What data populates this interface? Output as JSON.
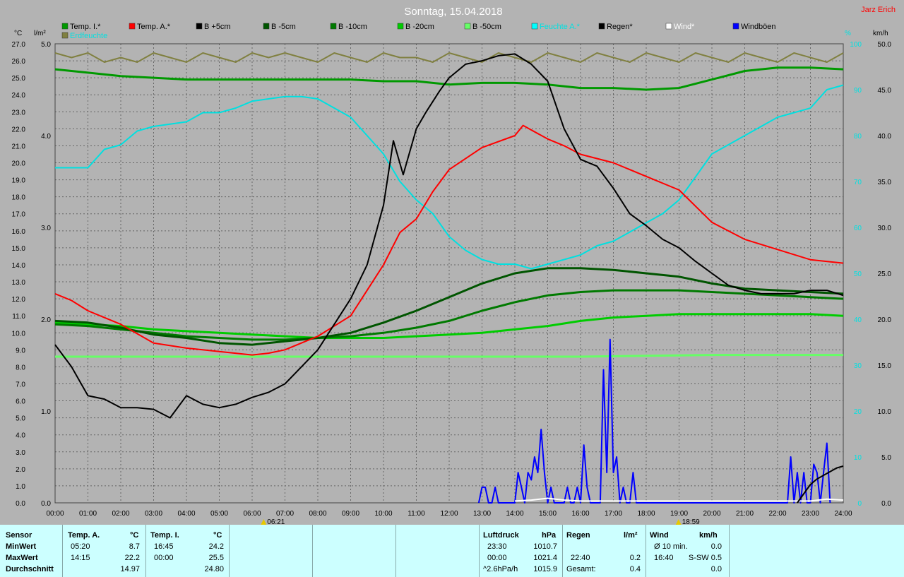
{
  "header": {
    "title": "Sonntag, 15.04.2018",
    "author": "Jarz Erich"
  },
  "colors": {
    "background": "#b3b3b3",
    "panel": "#ccffff",
    "grid": "#666666"
  },
  "units": {
    "left_temp": "°C",
    "left_rain": "l/m²",
    "right_percent": "%",
    "right_wind": "km/h"
  },
  "legend": [
    {
      "label": "Temp. I.*",
      "color": "#009900"
    },
    {
      "label": "Temp. A.*",
      "color": "#ff0000"
    },
    {
      "label": "B +5cm",
      "color": "#000000"
    },
    {
      "label": "B -5cm",
      "color": "#005500"
    },
    {
      "label": "B -10cm",
      "color": "#007a00"
    },
    {
      "label": "B -20cm",
      "color": "#00cc00"
    },
    {
      "label": "B -50cm",
      "color": "#66ff66"
    },
    {
      "label": "Feuchte A.*",
      "color": "#00ffff"
    },
    {
      "label": "Regen*",
      "color": "#000000"
    },
    {
      "label": "Wind*",
      "color": "#ffffff"
    },
    {
      "label": "Windböen",
      "color": "#0000ff"
    },
    {
      "label": "Erdfeuchte",
      "color": "#808040"
    }
  ],
  "chart_data": {
    "type": "line",
    "title": "Sonntag, 15.04.2018",
    "x_ticks": [
      "00:00",
      "01:00",
      "02:00",
      "03:00",
      "04:00",
      "05:00",
      "06:00",
      "07:00",
      "08:00",
      "09:00",
      "10:00",
      "11:00",
      "12:00",
      "13:00",
      "14:00",
      "15:00",
      "16:00",
      "17:00",
      "18:00",
      "19:00",
      "20:00",
      "21:00",
      "22:00",
      "23:00",
      "24:00"
    ],
    "xlim": [
      0,
      24
    ],
    "y_temp_ticks": [
      "0.0",
      "1.0",
      "2.0",
      "3.0",
      "4.0",
      "5.0",
      "6.0",
      "7.0",
      "8.0",
      "9.0",
      "10.0",
      "11.0",
      "12.0",
      "13.0",
      "14.0",
      "15.0",
      "16.0",
      "17.0",
      "18.0",
      "19.0",
      "20.0",
      "21.0",
      "22.0",
      "23.0",
      "24.0",
      "25.0",
      "26.0",
      "27.0"
    ],
    "y_temp_lim": [
      0,
      27
    ],
    "y_rain_ticks": [
      "0.0",
      "1.0",
      "2.0",
      "3.0",
      "4.0",
      "5.0"
    ],
    "y_rain_lim": [
      0,
      5
    ],
    "y_percent_ticks": [
      "0",
      "10",
      "20",
      "30",
      "40",
      "50",
      "60",
      "70",
      "80",
      "90",
      "100"
    ],
    "y_percent_lim": [
      0,
      100
    ],
    "y_wind_ticks": [
      "0.0",
      "5.0",
      "10.0",
      "15.0",
      "20.0",
      "25.0",
      "30.0",
      "35.0",
      "40.0",
      "45.0",
      "50.0"
    ],
    "y_wind_lim": [
      0,
      50
    ],
    "sunrise": "06:21",
    "sunset": "18:59",
    "series": [
      {
        "name": "Temp. I.*",
        "axis": "temp",
        "color": "#009900",
        "x": [
          0,
          1,
          2,
          3,
          4,
          5,
          6,
          7,
          8,
          9,
          10,
          11,
          12,
          13,
          14,
          15,
          16,
          17,
          18,
          19,
          20,
          21,
          22,
          23,
          24
        ],
        "y": [
          25.5,
          25.3,
          25.1,
          25.0,
          24.9,
          24.9,
          24.9,
          24.9,
          24.9,
          24.9,
          24.8,
          24.8,
          24.6,
          24.7,
          24.7,
          24.6,
          24.4,
          24.4,
          24.3,
          24.4,
          24.9,
          25.4,
          25.6,
          25.6,
          25.5
        ]
      },
      {
        "name": "Temp. A.*",
        "axis": "temp",
        "color": "#ff0000",
        "x": [
          0,
          0.5,
          1,
          2,
          3,
          4,
          5,
          6,
          6.5,
          7,
          8,
          9,
          9.5,
          10,
          10.5,
          11,
          11.5,
          12,
          13,
          14,
          14.25,
          15,
          15.5,
          16,
          17,
          18,
          19,
          20,
          21,
          22,
          23,
          24
        ],
        "y": [
          12.3,
          11.9,
          11.3,
          10.5,
          9.4,
          9.1,
          8.9,
          8.7,
          8.8,
          9.0,
          9.8,
          11.0,
          12.5,
          14.0,
          15.9,
          16.7,
          18.3,
          19.6,
          20.9,
          21.6,
          22.2,
          21.4,
          21.0,
          20.5,
          20.0,
          19.2,
          18.4,
          16.5,
          15.5,
          14.9,
          14.3,
          14.1
        ]
      },
      {
        "name": "B +5cm",
        "axis": "temp",
        "color": "#000000",
        "x": [
          0,
          0.5,
          1,
          1.5,
          2,
          2.5,
          3,
          3.5,
          4,
          4.5,
          5,
          5.5,
          6,
          6.5,
          7,
          7.5,
          8,
          8.5,
          9,
          9.5,
          10,
          10.3,
          10.6,
          11,
          11.3,
          11.7,
          12,
          12.5,
          13,
          13.5,
          14,
          14.5,
          15,
          15.5,
          16,
          16.5,
          17,
          17.5,
          18,
          18.5,
          19,
          19.5,
          20,
          20.5,
          21,
          21.5,
          22,
          22.5,
          23,
          23.5,
          24
        ],
        "y": [
          9.3,
          8.0,
          6.3,
          6.1,
          5.6,
          5.6,
          5.5,
          5.0,
          6.3,
          5.8,
          5.6,
          5.8,
          6.2,
          6.5,
          7.0,
          8.0,
          9.0,
          10.5,
          12.0,
          14.0,
          17.5,
          21.3,
          19.3,
          22.0,
          23.0,
          24.2,
          25.0,
          25.8,
          26.0,
          26.3,
          26.4,
          25.8,
          24.8,
          22.0,
          20.2,
          19.8,
          18.5,
          17.0,
          16.3,
          15.5,
          15.0,
          14.2,
          13.5,
          12.8,
          12.5,
          12.3,
          12.3,
          12.3,
          12.5,
          12.5,
          12.2
        ]
      },
      {
        "name": "B -5cm",
        "axis": "temp",
        "color": "#005500",
        "x": [
          0,
          1,
          2,
          3,
          4,
          5,
          6,
          7,
          8,
          9,
          10,
          11,
          12,
          13,
          14,
          15,
          16,
          17,
          18,
          19,
          20,
          21,
          22,
          23,
          24
        ],
        "y": [
          10.7,
          10.6,
          10.3,
          9.9,
          9.7,
          9.4,
          9.3,
          9.5,
          9.7,
          10.0,
          10.6,
          11.3,
          12.1,
          12.9,
          13.5,
          13.8,
          13.8,
          13.7,
          13.5,
          13.3,
          12.9,
          12.6,
          12.5,
          12.4,
          12.3
        ]
      },
      {
        "name": "B -10cm",
        "axis": "temp",
        "color": "#007a00",
        "x": [
          0,
          1,
          2,
          3,
          4,
          5,
          6,
          7,
          8,
          9,
          10,
          11,
          12,
          13,
          14,
          15,
          16,
          17,
          18,
          19,
          20,
          21,
          22,
          23,
          24
        ],
        "y": [
          10.5,
          10.4,
          10.2,
          10.0,
          9.8,
          9.7,
          9.6,
          9.6,
          9.7,
          9.8,
          10.0,
          10.3,
          10.7,
          11.3,
          11.8,
          12.2,
          12.4,
          12.5,
          12.5,
          12.5,
          12.4,
          12.3,
          12.2,
          12.1,
          12.0
        ]
      },
      {
        "name": "B -20cm",
        "axis": "temp",
        "color": "#00cc00",
        "x": [
          0,
          1,
          2,
          3,
          4,
          5,
          6,
          7,
          8,
          9,
          10,
          11,
          12,
          13,
          14,
          15,
          16,
          17,
          18,
          19,
          20,
          21,
          22,
          23,
          24
        ],
        "y": [
          10.6,
          10.5,
          10.4,
          10.2,
          10.1,
          10.0,
          9.9,
          9.8,
          9.7,
          9.7,
          9.7,
          9.8,
          9.9,
          10.0,
          10.2,
          10.4,
          10.7,
          10.9,
          11.0,
          11.1,
          11.1,
          11.1,
          11.1,
          11.1,
          11.0
        ]
      },
      {
        "name": "B -50cm",
        "axis": "temp",
        "color": "#66ff66",
        "x": [
          0,
          4,
          8,
          12,
          16,
          20,
          24
        ],
        "y": [
          8.6,
          8.6,
          8.6,
          8.6,
          8.6,
          8.7,
          8.7
        ]
      },
      {
        "name": "Feuchte A.*",
        "axis": "percent",
        "color": "#00e0e0",
        "x": [
          0,
          1,
          1.5,
          2,
          2.5,
          3,
          3.5,
          4,
          4.5,
          5,
          5.5,
          6,
          6.5,
          7,
          7.5,
          8,
          8.5,
          9,
          9.5,
          10,
          10.5,
          11,
          11.5,
          12,
          12.5,
          13,
          13.5,
          14,
          14.5,
          15,
          15.5,
          16,
          16.5,
          17,
          17.5,
          18,
          18.5,
          19,
          19.5,
          20,
          20.5,
          21,
          21.5,
          22,
          22.5,
          23,
          23.5,
          24
        ],
        "y": [
          73,
          73,
          77,
          78,
          81,
          82,
          82.5,
          83,
          85,
          85,
          86,
          87.5,
          88,
          88.5,
          88.5,
          88,
          86,
          84,
          80,
          76,
          70,
          66,
          63,
          58,
          55,
          53,
          52,
          52,
          51,
          52,
          53,
          54,
          56,
          57,
          59,
          61,
          63,
          66,
          71,
          76,
          78,
          80,
          82,
          84,
          85,
          86,
          90,
          91
        ]
      },
      {
        "name": "Erdfeuchte",
        "axis": "percent",
        "color": "#808040",
        "x": [
          0,
          0.5,
          1,
          1.5,
          2,
          2.5,
          3,
          3.5,
          4,
          4.5,
          5,
          5.5,
          6,
          6.5,
          7,
          7.5,
          8,
          8.5,
          9,
          9.5,
          10,
          10.5,
          11,
          11.5,
          12,
          12.5,
          13,
          13.5,
          14,
          14.5,
          15,
          15.5,
          16,
          16.5,
          17,
          17.5,
          18,
          18.5,
          19,
          19.5,
          20,
          20.5,
          21,
          21.5,
          22,
          22.5,
          23,
          23.5,
          24
        ],
        "y": [
          98,
          97,
          98,
          96,
          97,
          96,
          98,
          97,
          96,
          98,
          97,
          96,
          98,
          97,
          98,
          97,
          96,
          98,
          97,
          96,
          98,
          97,
          97,
          96,
          98,
          97,
          96,
          98,
          97,
          96,
          98,
          97,
          96,
          98,
          97,
          96,
          98,
          97,
          96,
          98,
          97,
          96,
          98,
          97,
          96,
          98,
          97,
          96,
          98
        ]
      },
      {
        "name": "Windböen",
        "axis": "wind",
        "color": "#0000ff",
        "x": [
          12.9,
          13.0,
          13.1,
          13.2,
          13.3,
          13.4,
          13.5,
          13.6,
          14.0,
          14.1,
          14.2,
          14.3,
          14.4,
          14.5,
          14.6,
          14.7,
          14.8,
          14.9,
          15.0,
          15.1,
          15.2,
          15.3,
          15.5,
          15.6,
          15.7,
          15.8,
          15.9,
          16.0,
          16.1,
          16.2,
          16.3,
          16.4,
          16.5,
          16.6,
          16.7,
          16.8,
          16.9,
          17.0,
          17.1,
          17.2,
          17.3,
          17.4,
          17.5,
          17.6,
          17.7,
          22.3,
          22.4,
          22.5,
          22.6,
          22.7,
          22.8,
          22.9,
          23.0,
          23.1,
          23.2,
          23.3,
          23.4,
          23.5,
          23.6
        ],
        "y": [
          0,
          1.7,
          1.7,
          0,
          0,
          1.7,
          0,
          0,
          0,
          3.3,
          1.7,
          0,
          3.3,
          2.5,
          5,
          3.3,
          8,
          3.3,
          0,
          1.7,
          0,
          0,
          0,
          1.7,
          0,
          0,
          1.7,
          0,
          6.3,
          1.7,
          0,
          0,
          0,
          0,
          14.5,
          3.3,
          17.8,
          3.3,
          5,
          0,
          1.7,
          0,
          0,
          3.3,
          0,
          0,
          5,
          0,
          3.3,
          0,
          3.3,
          0,
          0,
          4.2,
          3.3,
          0,
          3.3,
          6.5,
          0
        ]
      },
      {
        "name": "Wind*",
        "axis": "wind",
        "color": "#ffffff",
        "x": [
          14.0,
          14.5,
          15.0,
          15.5,
          16.0,
          17.0,
          23.0,
          23.5,
          24.0
        ],
        "y": [
          0.2,
          0.3,
          0.5,
          0.3,
          0.2,
          0.2,
          0.2,
          0.4,
          0.3
        ]
      },
      {
        "name": "Regen*",
        "axis": "rain",
        "color": "#000000",
        "x": [
          22.6,
          22.8,
          23.0,
          23.2,
          23.5,
          23.8,
          24.0
        ],
        "y": [
          0.0,
          0.1,
          0.2,
          0.26,
          0.32,
          0.38,
          0.4
        ]
      }
    ]
  },
  "panel": {
    "sensor": {
      "label": "Sensor",
      "rows": [
        "MinWert",
        "MaxWert",
        "Durchschnitt"
      ]
    },
    "temp_a": {
      "label": "Temp. A.",
      "unit": "°C",
      "min_time": "05:20",
      "min": "8.7",
      "max_time": "14:15",
      "max": "22.2",
      "avg": "14.97"
    },
    "temp_i": {
      "label": "Temp. I.",
      "unit": "°C",
      "min_time": "16:45",
      "min": "24.2",
      "max_time": "00:00",
      "max": "25.5",
      "avg": "24.80"
    },
    "luftdruck": {
      "label": "Luftdruck",
      "unit": "hPa",
      "min_time": "23:30",
      "min": "1010.7",
      "max_time": "00:00",
      "max": "1021.4",
      "trend": "^2.6hPa/h",
      "avg": "1015.9"
    },
    "regen": {
      "label": "Regen",
      "unit": "l/m²",
      "max_time": "22:40",
      "max": "0.2",
      "total_label": "Gesamt:",
      "total": "0.4"
    },
    "wind": {
      "label": "Wind",
      "unit": "km/h",
      "avg_label": "Ø 10 min.",
      "avg": "0.0",
      "max_time": "16:40",
      "max_dir": "S-SW 0.5",
      "last": "0.0"
    }
  }
}
